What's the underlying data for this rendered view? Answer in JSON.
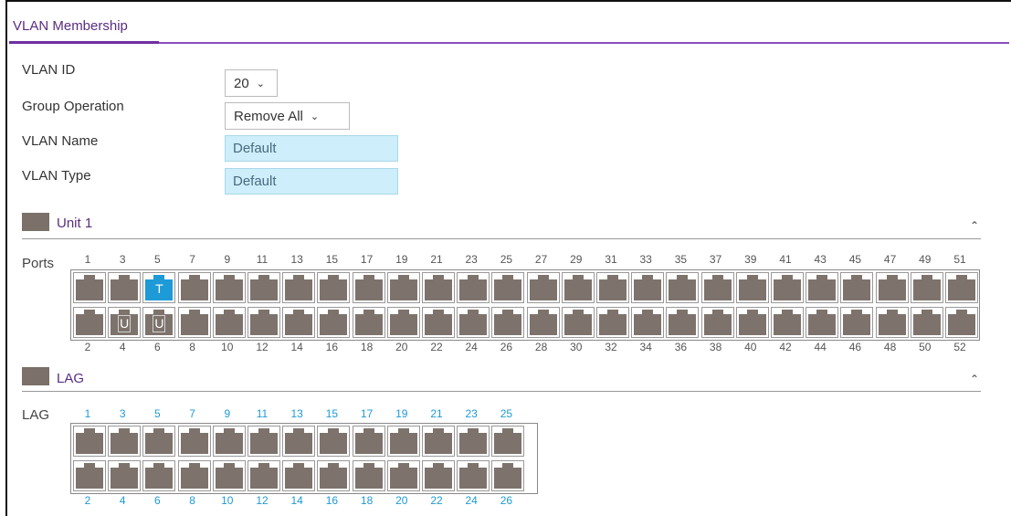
{
  "tab": {
    "title": "VLAN Membership"
  },
  "form": {
    "vlan_id_label": "VLAN ID",
    "vlan_id_value": "20",
    "group_operation_label": "Group Operation",
    "group_operation_value": "Remove All",
    "vlan_name_label": "VLAN Name",
    "vlan_name_value": "Default",
    "vlan_type_label": "VLAN Type",
    "vlan_type_value": "Default"
  },
  "unit": {
    "title": "Unit 1",
    "row_label": "Ports",
    "top_numbers": [
      "1",
      "3",
      "5",
      "7",
      "9",
      "11",
      "13",
      "15",
      "17",
      "19",
      "21",
      "23",
      "25",
      "27",
      "29",
      "31",
      "33",
      "35",
      "37",
      "39",
      "41",
      "43",
      "45",
      "47",
      "49",
      "51"
    ],
    "bottom_numbers": [
      "2",
      "4",
      "6",
      "8",
      "10",
      "12",
      "14",
      "16",
      "18",
      "20",
      "22",
      "24",
      "26",
      "28",
      "30",
      "32",
      "34",
      "36",
      "38",
      "40",
      "42",
      "44",
      "46",
      "48",
      "50",
      "52"
    ],
    "port_states": {
      "5": "T",
      "4": "U",
      "6": "U"
    }
  },
  "lag": {
    "title": "LAG",
    "row_label": "LAG",
    "top_numbers": [
      "1",
      "3",
      "5",
      "7",
      "9",
      "11",
      "13",
      "15",
      "17",
      "19",
      "21",
      "23",
      "25"
    ],
    "bottom_numbers": [
      "2",
      "4",
      "6",
      "8",
      "10",
      "12",
      "14",
      "16",
      "18",
      "20",
      "22",
      "24",
      "26"
    ]
  },
  "colors": {
    "accent": "#5a2d82",
    "tab_line": "#8a4fbf",
    "tagged": "#1e9ad6",
    "port": "#7d736c",
    "field_bg": "#cdeefa",
    "lag_numbers": "#1e9ad6"
  },
  "icons": {
    "collapse": "chevron-up-icon",
    "section": "port-block-icon",
    "select": "chevron-down-icon"
  }
}
